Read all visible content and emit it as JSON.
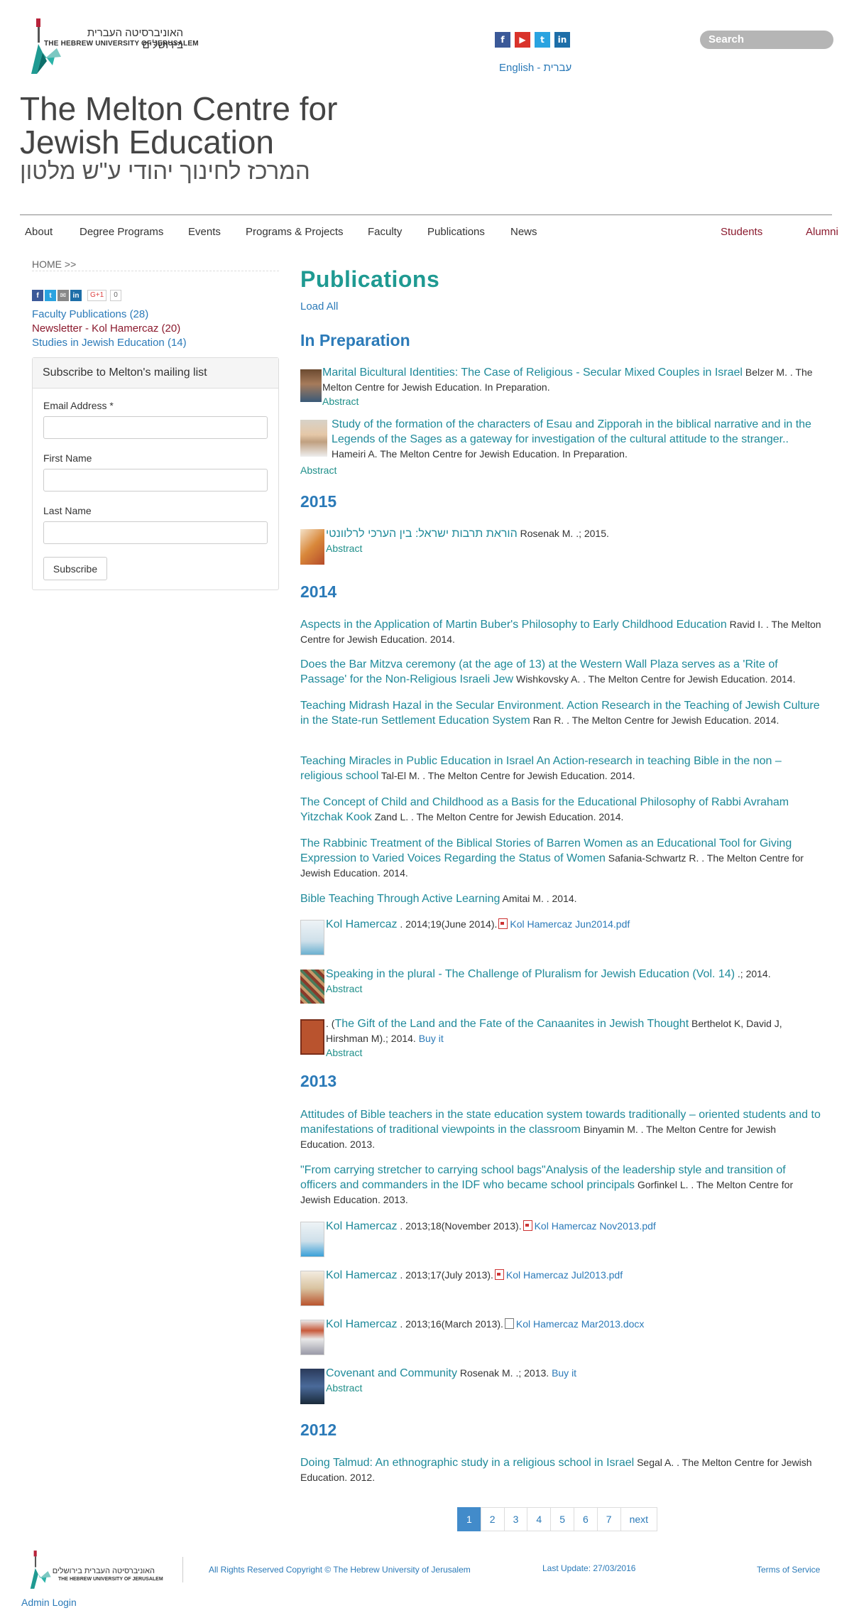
{
  "header": {
    "logo_he": "האוניברסיטה העברית בירושלים",
    "logo_en": "THE HEBREW UNIVERSITY OF JERUSALEM",
    "lang_en": "English",
    "lang_sep": "-",
    "lang_he": "עברית",
    "search_placeholder": "Search",
    "site_title": "The Melton Centre for Jewish Education",
    "site_title_he": "המרכז לחינוך יהודי ע\"ש מלטון"
  },
  "social_icons": [
    "facebook-icon",
    "youtube-icon",
    "twitter-icon",
    "linkedin-icon"
  ],
  "nav": {
    "about": "About",
    "degree": "Degree Programs",
    "events": "Events",
    "programs": "Programs & Projects",
    "faculty": "Faculty",
    "publications": "Publications",
    "news": "News",
    "students": "Students",
    "alumni": "Alumni"
  },
  "sidebar": {
    "breadcrumb": "HOME >>",
    "gplus": "G+1",
    "gcount": "0",
    "links": [
      "Faculty Publications (28)",
      "Newsletter - Kol Hamercaz (20)",
      "Studies in Jewish Education (14)"
    ],
    "subscribe": {
      "title": "Subscribe to Melton's mailing list",
      "email_label": "Email Address *",
      "first_label": "First Name",
      "last_label": "Last Name",
      "button": "Subscribe"
    }
  },
  "main": {
    "title": "Publications",
    "load_all": "Load All",
    "sections": {
      "prep": "In Preparation",
      "y2015": "2015",
      "y2014": "2014",
      "y2013": "2013",
      "y2012": "2012"
    },
    "abstract": "Abstract",
    "buy_it": "Buy it",
    "items": {
      "p1_title": "Marital Bicultural Identities: The Case of Religious - Secular Mixed Couples in Israel",
      "p1_meta": "Belzer M. . The Melton Centre for Jewish Education. In Preparation.",
      "p2_title": "Study of the formation of the characters of Esau and Zipporah in the biblical narrative and in the Legends of the Sages as a gateway for investigation of the cultural attitude to the stranger..",
      "p2_meta": "Hameiri A. The Melton Centre for Jewish Education. In Preparation.",
      "a15_title": "הוראת תרבות ישראל: בין הערכי לרלוונטי",
      "a15_meta": "Rosenak M. .; 2015.",
      "b1_title": "Aspects in the Application of Martin Buber's Philosophy to Early Childhood Education",
      "b1_meta": "Ravid I. . The Melton Centre for Jewish Education. 2014.",
      "b2_title": "Does the Bar Mitzva ceremony (at the age of 13) at the Western Wall Plaza serves as a 'Rite of Passage' for the Non-Religious Israeli Jew",
      "b2_meta": "Wishkovsky A. . The Melton Centre for Jewish Education. 2014.",
      "b3_title": "Teaching Midrash Hazal in the Secular Environment. Action Research in the Teaching of Jewish Culture in the State-run Settlement Education System",
      "b3_meta": "Ran R. . The Melton Centre for Jewish Education. 2014.",
      "b4_title": "Teaching Miracles in Public Education in Israel An Action-research in teaching Bible in the non – religious school",
      "b4_meta": "Tal-El M. . The Melton Centre for Jewish Education. 2014.",
      "b5_title": "The Concept of Child and Childhood as a Basis for the Educational Philosophy of Rabbi Avraham Yitzchak Kook",
      "b5_meta": "Zand L. . The Melton Centre for Jewish Education. 2014.",
      "b6_title": "The Rabbinic Treatment of the Biblical Stories of Barren Women as an Educational Tool for Giving Expression to Varied Voices Regarding the Status of Women",
      "b6_meta": "Safania-Schwartz R. . The Melton Centre for Jewish Education. 2014.",
      "b7_title": "Bible Teaching Through Active Learning",
      "b7_meta": "Amitai M. . 2014.",
      "b8_title": "Kol Hamercaz",
      "b8_meta": ". 2014;19(June 2014).",
      "b8_file": "Kol Hamercaz Jun2014.pdf",
      "b9_title": "Speaking in the plural - The Challenge of Pluralism for Jewish Education (Vol. 14)",
      "b9_meta": ".; 2014.",
      "b10_pre": ". (",
      "b10_title": "The Gift of the Land and the Fate of the Canaanites in Jewish Thought",
      "b10_meta": "Berthelot K, David J, Hirshman M).; 2014.",
      "c1_title": "Attitudes of Bible teachers in the state education system towards traditionally – oriented students and to manifestations of traditional viewpoints in the classroom",
      "c1_meta": "Binyamin M. . The Melton Centre for Jewish Education. 2013.",
      "c2_title": "\"From carrying stretcher to carrying school bags\"Analysis of the leadership style and transition of officers and commanders in the IDF who became school principals",
      "c2_meta": "Gorfinkel L. . The Melton Centre for Jewish Education. 2013.",
      "c3_title": "Kol Hamercaz",
      "c3_meta": ". 2013;18(November 2013).",
      "c3_file": "Kol Hamercaz Nov2013.pdf",
      "c4_title": "Kol Hamercaz",
      "c4_meta": ". 2013;17(July 2013).",
      "c4_file": "Kol Hamercaz Jul2013.pdf",
      "c5_title": "Kol Hamercaz",
      "c5_meta": ". 2013;16(March 2013).",
      "c5_file": "Kol Hamercaz Mar2013.docx",
      "c6_title": "Covenant and Community",
      "c6_meta": "Rosenak M. .; 2013.",
      "d1_title": "Doing Talmud: An ethnographic study in a religious school in Israel",
      "d1_meta": "Segal A. . The Melton Centre for Jewish Education. 2012."
    }
  },
  "pager": [
    "1",
    "2",
    "3",
    "4",
    "5",
    "6",
    "7",
    "next"
  ],
  "footer": {
    "copyright": "All Rights Reserved Copyright © The Hebrew University of Jerusalem",
    "last_update": "Last Update: 27/03/2016",
    "tos": "Terms of Service",
    "admin": "Admin Login"
  },
  "colors": {
    "accent_teal": "#1f9a92",
    "link_blue": "#2b7ab8",
    "nav_red": "#8b1a2e"
  }
}
